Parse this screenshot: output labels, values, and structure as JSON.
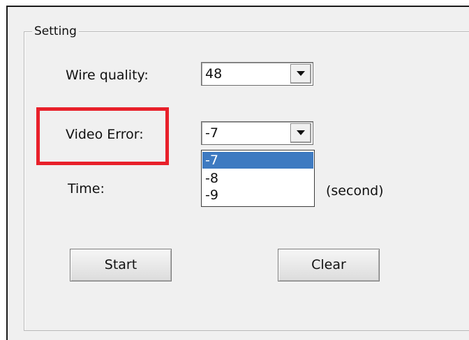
{
  "group": {
    "title": "Setting"
  },
  "wire_quality": {
    "label": "Wire quality:",
    "value": "48"
  },
  "video_error": {
    "label": "Video Error:",
    "value": "-7",
    "options": [
      "-7",
      "-8",
      "-9"
    ],
    "selected_option": "-7"
  },
  "time": {
    "label": "Time:",
    "unit": "(second)"
  },
  "buttons": {
    "start": "Start",
    "clear": "Clear"
  },
  "icons": {
    "dropdown_arrow": "chevron-down-icon"
  },
  "colors": {
    "highlight": "#e8202a",
    "selection": "#3e7ac1"
  }
}
